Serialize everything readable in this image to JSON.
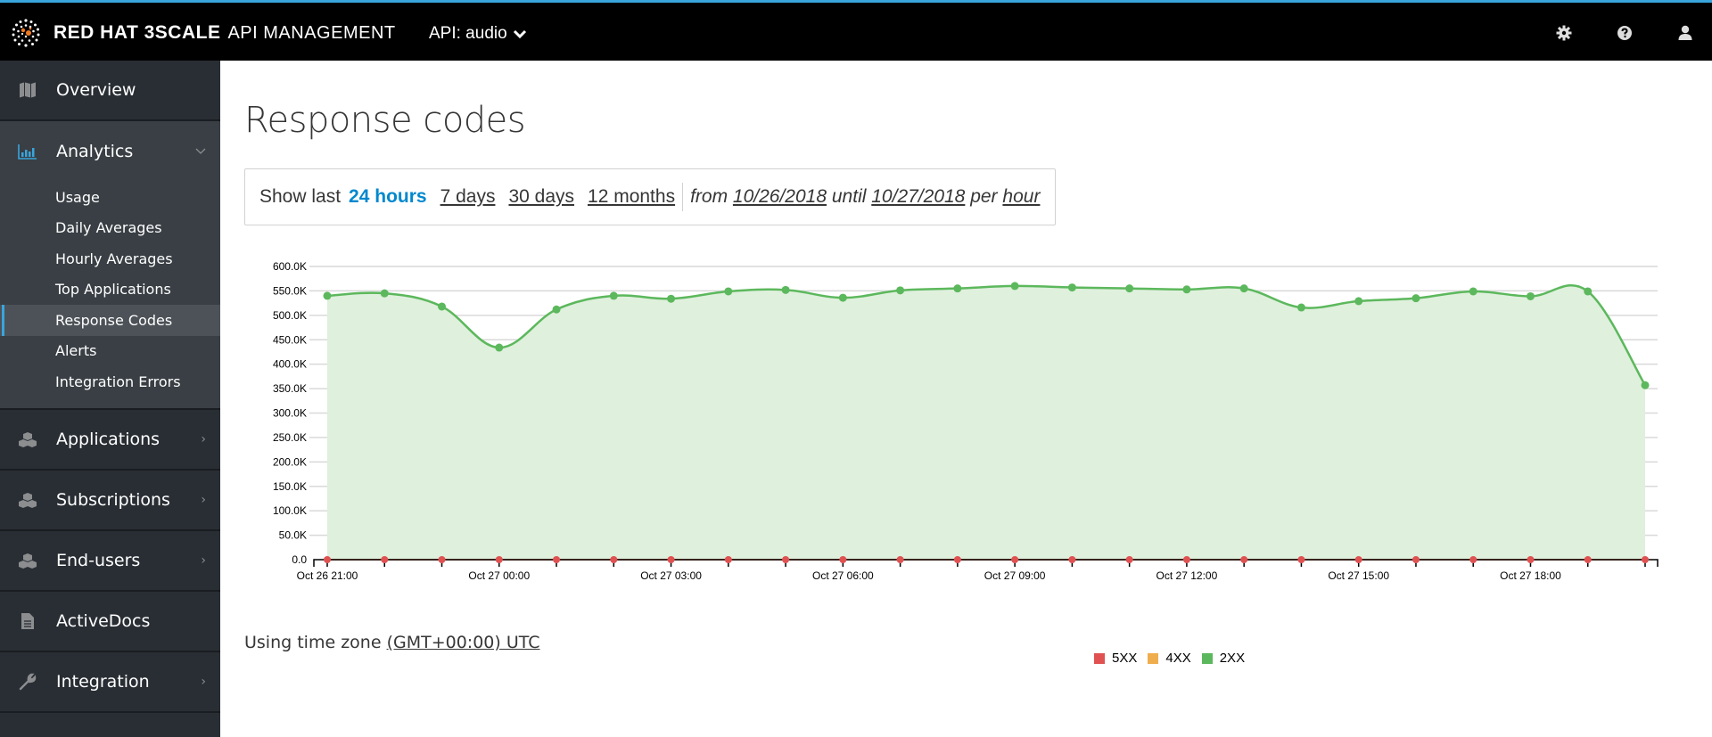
{
  "header": {
    "brand_name": "RED HAT 3SCALE",
    "brand_sub": "API MANAGEMENT",
    "api_selector": "API: audio",
    "icons": [
      "gear-icon",
      "help-icon",
      "user-icon"
    ]
  },
  "sidebar": {
    "items": [
      {
        "label": "Overview",
        "icon": "map-icon"
      },
      {
        "label": "Analytics",
        "icon": "bar-chart-icon",
        "expanded": true
      },
      {
        "label": "Applications",
        "icon": "cubes-icon"
      },
      {
        "label": "Subscriptions",
        "icon": "cubes-icon"
      },
      {
        "label": "End-users",
        "icon": "cubes-icon"
      },
      {
        "label": "ActiveDocs",
        "icon": "file-icon"
      },
      {
        "label": "Integration",
        "icon": "wrench-icon"
      }
    ],
    "analytics_sub": [
      {
        "label": "Usage"
      },
      {
        "label": "Daily Averages"
      },
      {
        "label": "Hourly Averages"
      },
      {
        "label": "Top Applications"
      },
      {
        "label": "Response Codes",
        "current": true
      },
      {
        "label": "Alerts"
      },
      {
        "label": "Integration Errors"
      }
    ]
  },
  "main": {
    "title": "Response codes",
    "range": {
      "show_last": "Show last",
      "options": [
        "24 hours",
        "7 days",
        "30 days",
        "12 months"
      ],
      "selected": "24 hours",
      "from_label": "from",
      "from_date": "10/26/2018",
      "until_label": "until",
      "until_date": "10/27/2018",
      "per_label": "per",
      "granularity": "hour"
    },
    "timezone_label": "Using time zone",
    "timezone_value": "(GMT+00:00) UTC"
  },
  "chart_data": {
    "type": "area",
    "title": "",
    "xlabel": "",
    "ylabel": "",
    "ylim": [
      0,
      600000
    ],
    "y_ticks": [
      "0.0",
      "50.0K",
      "100.0K",
      "150.0K",
      "200.0K",
      "250.0K",
      "300.0K",
      "350.0K",
      "400.0K",
      "450.0K",
      "500.0K",
      "550.0K",
      "600.0K"
    ],
    "x_tick_labels": [
      "Oct 26 21:00",
      "Oct 27 00:00",
      "Oct 27 03:00",
      "Oct 27 06:00",
      "Oct 27 09:00",
      "Oct 27 12:00",
      "Oct 27 15:00",
      "Oct 27 18:00"
    ],
    "x": [
      "Oct 26 21:00",
      "Oct 26 22:00",
      "Oct 26 23:00",
      "Oct 27 00:00",
      "Oct 27 01:00",
      "Oct 27 02:00",
      "Oct 27 03:00",
      "Oct 27 04:00",
      "Oct 27 05:00",
      "Oct 27 06:00",
      "Oct 27 07:00",
      "Oct 27 08:00",
      "Oct 27 09:00",
      "Oct 27 10:00",
      "Oct 27 11:00",
      "Oct 27 12:00",
      "Oct 27 13:00",
      "Oct 27 14:00",
      "Oct 27 15:00",
      "Oct 27 16:00",
      "Oct 27 17:00",
      "Oct 27 18:00",
      "Oct 27 19:00",
      "Oct 27 20:00"
    ],
    "grid": true,
    "legend_position": "bottom-center",
    "series": [
      {
        "name": "5XX",
        "color": "#e05252",
        "values": [
          0,
          0,
          0,
          0,
          0,
          0,
          0,
          0,
          0,
          0,
          0,
          0,
          0,
          0,
          0,
          0,
          0,
          0,
          0,
          0,
          0,
          0,
          0,
          0
        ]
      },
      {
        "name": "4XX",
        "color": "#f0ad4e",
        "values": [
          0,
          0,
          0,
          0,
          0,
          0,
          0,
          0,
          0,
          0,
          0,
          0,
          0,
          0,
          0,
          0,
          0,
          0,
          0,
          0,
          0,
          0,
          0,
          0
        ]
      },
      {
        "name": "2XX",
        "color": "#5cb85c",
        "values": [
          540000,
          545000,
          518000,
          434000,
          512000,
          540000,
          534000,
          549000,
          552000,
          536000,
          551000,
          555000,
          560000,
          557000,
          555000,
          553000,
          555000,
          516000,
          529000,
          535000,
          549000,
          539000,
          549000,
          357000
        ]
      }
    ]
  }
}
